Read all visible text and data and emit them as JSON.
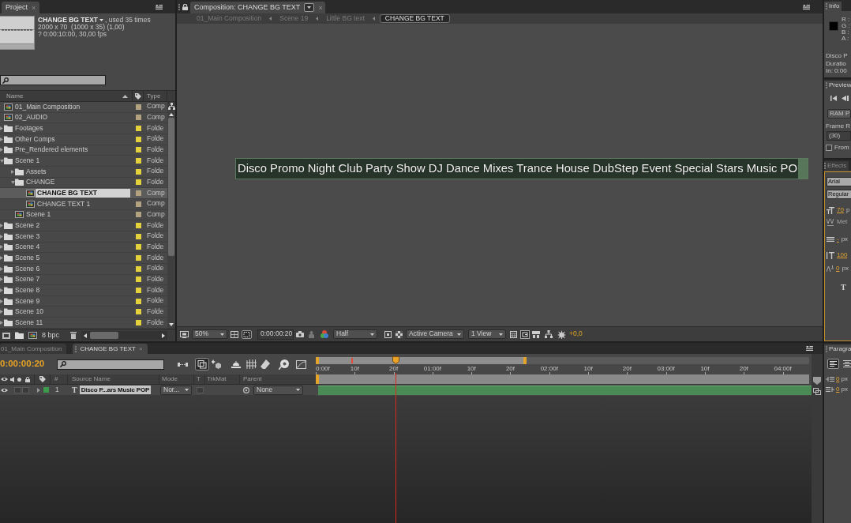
{
  "project": {
    "tab": {
      "label": "Project",
      "close": "×"
    },
    "summary": {
      "name": "CHANGE BG TEXT",
      "usage": ", used 35 times",
      "size": "2000 x 70  (1000 x 35) (1,00)",
      "duration": "? 0:00:10:00, 30,00 fps"
    },
    "columns": {
      "name": "Name",
      "type": "Type"
    },
    "items": [
      {
        "kind": "comp",
        "name": "01_Main Composition",
        "type": "Comp",
        "color": "#b3a27f",
        "selected": false
      },
      {
        "kind": "comp",
        "name": "02_AUDIO",
        "type": "Comp",
        "color": "#b3a27f",
        "selected": false
      },
      {
        "kind": "folder",
        "name": "Footages",
        "type": "Folde",
        "color": "#e3d23c",
        "selected": false,
        "expanded": false
      },
      {
        "kind": "folder",
        "name": "Other Comps",
        "type": "Folde",
        "color": "#e3d23c",
        "selected": false,
        "expanded": false
      },
      {
        "kind": "folder",
        "name": "Pre_Rendered elements",
        "type": "Folde",
        "color": "#e3d23c",
        "selected": false,
        "expanded": false
      },
      {
        "kind": "folder",
        "name": "Scene 1",
        "type": "Folde",
        "color": "#e3d23c",
        "selected": false,
        "expanded": true,
        "children": [
          {
            "kind": "folder",
            "name": "Assets",
            "type": "Folde",
            "color": "#e3d23c",
            "selected": false,
            "expanded": false
          },
          {
            "kind": "folder",
            "name": "CHANGE",
            "type": "Folde",
            "color": "#e3d23c",
            "selected": false,
            "expanded": true,
            "children": [
              {
                "kind": "comp",
                "name": "CHANGE BG TEXT",
                "type": "Comp",
                "color": "#b3a27f",
                "selected": true
              },
              {
                "kind": "comp",
                "name": "CHANGE TEXT 1",
                "type": "Comp",
                "color": "#b3a27f",
                "selected": false
              }
            ]
          },
          {
            "kind": "comp",
            "name": "Scene 1",
            "type": "Comp",
            "color": "#b3a27f",
            "selected": false
          }
        ]
      },
      {
        "kind": "folder",
        "name": "Scene 2",
        "type": "Folde",
        "color": "#e3d23c",
        "selected": false,
        "expanded": false
      },
      {
        "kind": "folder",
        "name": "Scene 3",
        "type": "Folde",
        "color": "#e3d23c",
        "selected": false,
        "expanded": false
      },
      {
        "kind": "folder",
        "name": "Scene 4",
        "type": "Folde",
        "color": "#e3d23c",
        "selected": false,
        "expanded": false
      },
      {
        "kind": "folder",
        "name": "Scene 5",
        "type": "Folde",
        "color": "#e3d23c",
        "selected": false,
        "expanded": false
      },
      {
        "kind": "folder",
        "name": "Scene 6",
        "type": "Folde",
        "color": "#e3d23c",
        "selected": false,
        "expanded": false
      },
      {
        "kind": "folder",
        "name": "Scene 7",
        "type": "Folde",
        "color": "#e3d23c",
        "selected": false,
        "expanded": false
      },
      {
        "kind": "folder",
        "name": "Scene 8",
        "type": "Folde",
        "color": "#e3d23c",
        "selected": false,
        "expanded": false
      },
      {
        "kind": "folder",
        "name": "Scene 9",
        "type": "Folde",
        "color": "#e3d23c",
        "selected": false,
        "expanded": false
      },
      {
        "kind": "folder",
        "name": "Scene 10",
        "type": "Folde",
        "color": "#e3d23c",
        "selected": false,
        "expanded": false
      },
      {
        "kind": "folder",
        "name": "Scene 11",
        "type": "Folde",
        "color": "#e3d23c",
        "selected": false,
        "expanded": false
      }
    ],
    "footer": {
      "bit_depth": "8 bpc"
    }
  },
  "composition": {
    "tab": {
      "label": "Composition: CHANGE BG TEXT",
      "close": "×"
    },
    "breadcrumbs": [
      {
        "label": "01_Main Composition",
        "selected": false
      },
      {
        "label": "Scene 19",
        "selected": false
      },
      {
        "label": "Little BG text",
        "selected": false
      },
      {
        "label": "CHANGE BG TEXT",
        "selected": true
      }
    ],
    "layer_text": "Disco Promo Night Club Party Show DJ Dance Mixes Trance House DubStep Event Special Stars Music PO",
    "toolbar": {
      "zoom": "50%",
      "timecode": "0:00:00:20",
      "resolution": "Half",
      "camera": "Active Camera",
      "views": "1 View",
      "exposure": "+0,0"
    }
  },
  "info": {
    "tab": "Info",
    "channels": [
      "R :",
      "G :",
      "B :",
      "A :"
    ],
    "lines": [
      "Disco P",
      "Duratio",
      "In: 0:00"
    ]
  },
  "preview": {
    "tab": "Preview",
    "ram_button": "RAM P",
    "frame_rate_label": "Frame R",
    "frame_rate": "(30)",
    "from_checkbox": {
      "label": "From",
      "checked": false
    }
  },
  "character": {
    "tab": "Effects",
    "font": "Arial",
    "style": "Regular",
    "size": {
      "value": "70",
      "unit": "p"
    },
    "kerning": "Met",
    "leading": {
      "value": "-",
      "unit": "px"
    },
    "vertical_scale": "100",
    "baseline": {
      "value": "0",
      "unit": "px"
    },
    "faux_bold": "T"
  },
  "timeline": {
    "tabs": [
      {
        "label": "01_Main Composition",
        "selected": false
      },
      {
        "label": "CHANGE BG TEXT",
        "selected": true,
        "close": "×"
      }
    ],
    "timecode": "0:00:00:20",
    "ruler": [
      "0:00f",
      "10f",
      "20f",
      "01:00f",
      "10f",
      "20f",
      "02:00f",
      "10f",
      "20f",
      "03:00f",
      "10f",
      "20f",
      "04:00f"
    ],
    "columns": {
      "number": "#",
      "source_name": "Source Name",
      "mode": "Mode",
      "t": "T",
      "track_matte": "TrkMat",
      "parent": "Parent"
    },
    "layers": [
      {
        "number": "1",
        "type_icon": "T",
        "name": "Disco P...ars Music POP",
        "mode": "Nor...",
        "preserve_transparency": false,
        "parent": "None",
        "color": "#3d9a4c",
        "selected": true
      }
    ]
  },
  "paragraph": {
    "tab": "Paragra",
    "indents": [
      {
        "value": "0",
        "unit": "px"
      },
      {
        "value": "0",
        "unit": "px"
      }
    ]
  }
}
